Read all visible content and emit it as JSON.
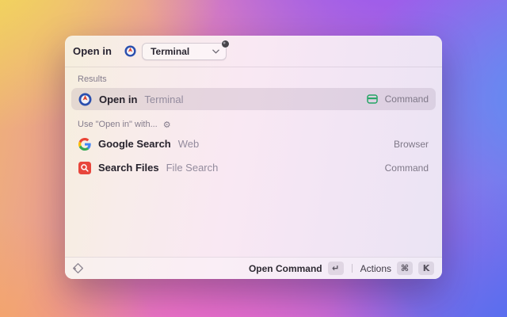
{
  "header": {
    "label": "Open in",
    "argument_value": "Terminal"
  },
  "sections": {
    "results": {
      "title": "Results"
    },
    "use_with": {
      "title": "Use \"Open in\" with..."
    }
  },
  "list": {
    "selected": {
      "title": "Open in",
      "subtitle": "Terminal",
      "accessory": "Command"
    },
    "items": [
      {
        "title": "Google Search",
        "subtitle": "Web",
        "accessory": "Browser"
      },
      {
        "title": "Search Files",
        "subtitle": "File Search",
        "accessory": "Command"
      }
    ]
  },
  "footer": {
    "primary_action": "Open Command",
    "primary_key": "↵",
    "secondary_action": "Actions",
    "key_cmd": "⌘",
    "key_k": "K"
  },
  "icons": {
    "gear": "⚙"
  },
  "colors": {
    "accent_green": "#24a564",
    "search_files_red": "#e8463c",
    "google_blue": "#4285F4",
    "google_red": "#EA4335",
    "google_yellow": "#FBBC05",
    "google_green": "#34A853",
    "selection": "rgba(104,80,110,0.13)"
  }
}
